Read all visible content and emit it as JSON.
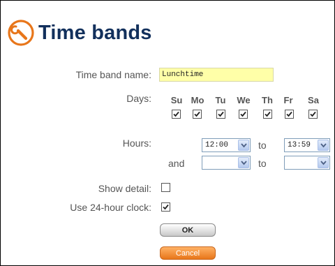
{
  "header": {
    "title": "Time bands",
    "icon": "wrench-icon"
  },
  "form": {
    "name_label": "Time band name:",
    "name_value": "Lunchtime",
    "days_label": "Days:",
    "days": [
      {
        "label": "Su",
        "checked": true
      },
      {
        "label": "Mo",
        "checked": true
      },
      {
        "label": "Tu",
        "checked": true
      },
      {
        "label": "We",
        "checked": true
      },
      {
        "label": "Th",
        "checked": true
      },
      {
        "label": "Fr",
        "checked": true
      },
      {
        "label": "Sa",
        "checked": true
      }
    ],
    "hours_label": "Hours:",
    "hours_from_1": "12:00",
    "to_label": "to",
    "hours_to_1": "13:59",
    "and_label": "and",
    "hours_from_2": "",
    "hours_to_2": "",
    "show_detail_label": "Show detail:",
    "show_detail_checked": false,
    "use24_label": "Use 24-hour clock:",
    "use24_checked": true
  },
  "buttons": {
    "ok": "OK",
    "cancel": "Cancel"
  },
  "colors": {
    "title": "#12305c",
    "accent": "#e8761a",
    "name_bg": "#ffffa8"
  }
}
